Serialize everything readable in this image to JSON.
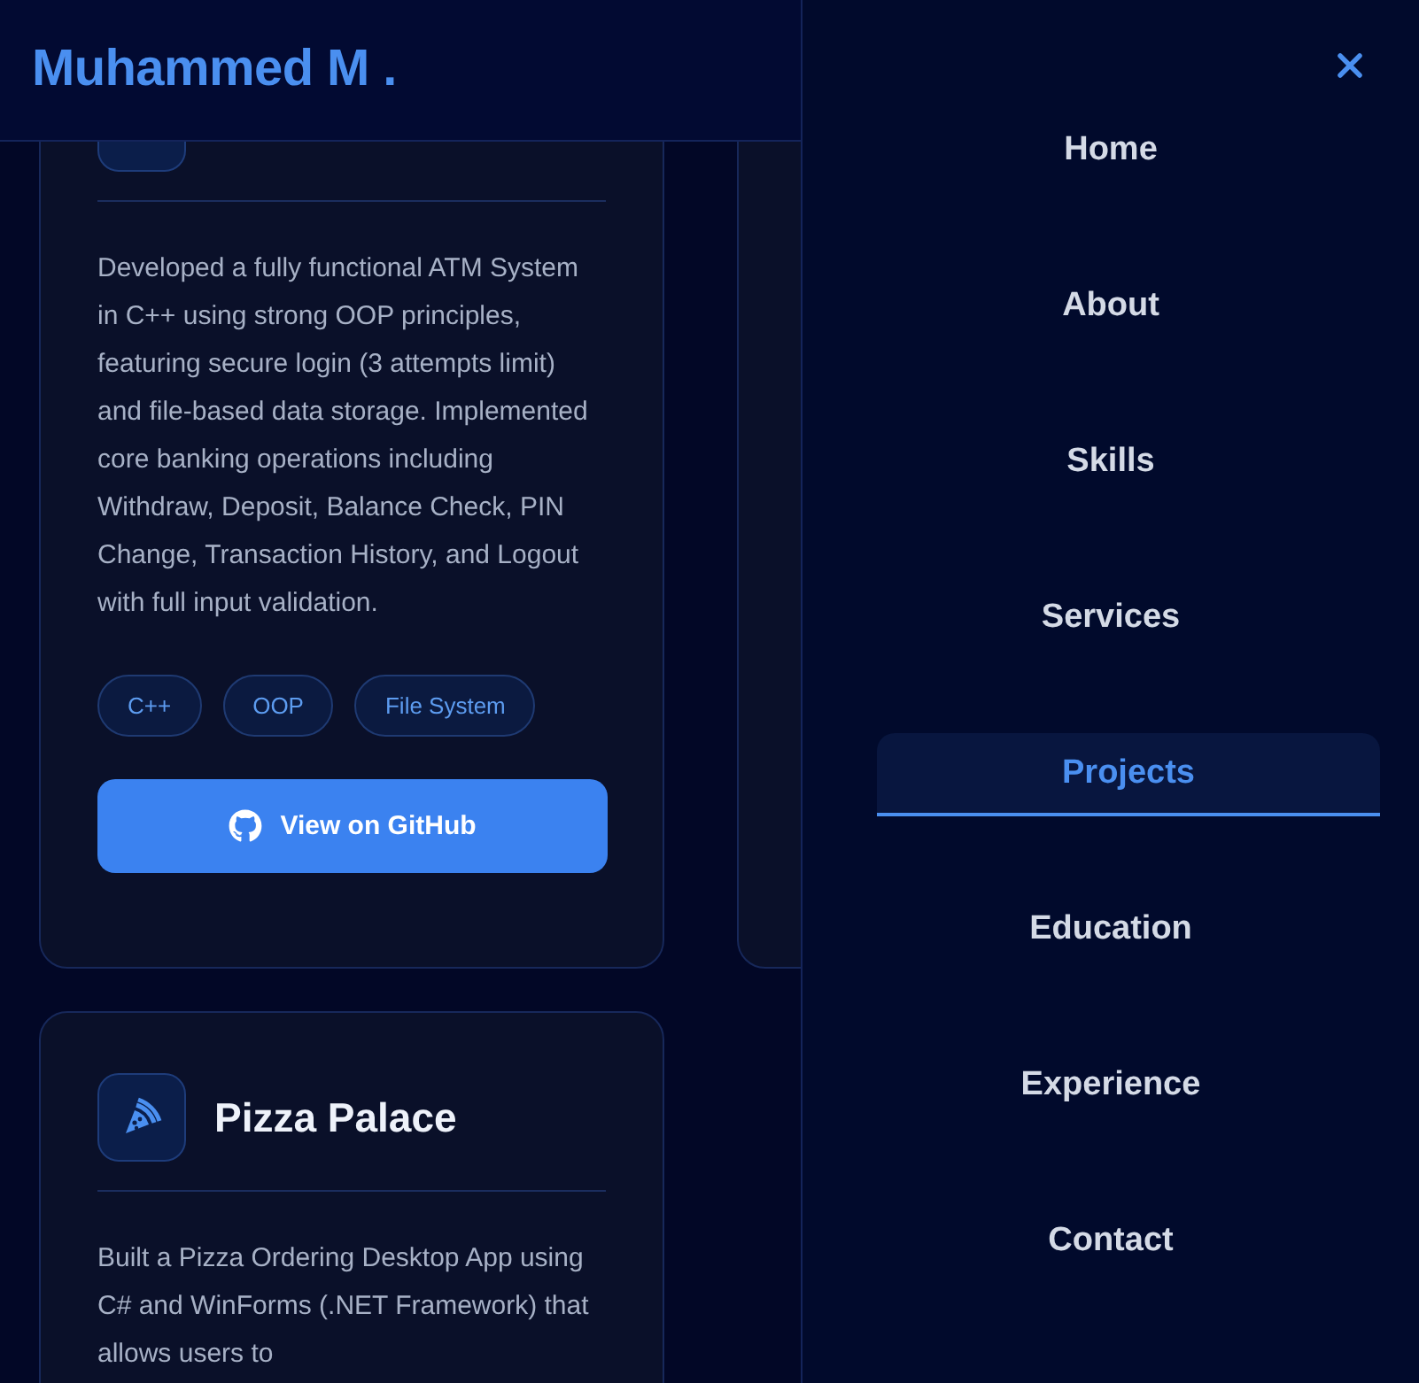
{
  "header": {
    "logo": "Muhammed M ."
  },
  "projects": [
    {
      "kind": "github",
      "description": "Developed a fully functional ATM System in C++ using strong OOP principles, featuring secure login (3 attempts limit) and file-based data storage. Implemented core banking operations including Withdraw, Deposit, Balance Check, PIN Change, Transaction History, and Logout with full input validation.",
      "tags": [
        "C++",
        "OOP",
        "File System"
      ],
      "button": "View on GitHub"
    },
    {
      "kind": "hidden"
    },
    {
      "kind": "titled",
      "title": "Pizza Palace",
      "description": "Built a Pizza Ordering Desktop App using C# and WinForms (.NET Framework) that allows users to"
    }
  ],
  "menu": {
    "items": [
      {
        "label": "Home",
        "selected": false
      },
      {
        "label": "About",
        "selected": false
      },
      {
        "label": "Skills",
        "selected": false
      },
      {
        "label": "Services",
        "selected": false
      },
      {
        "label": "Projects",
        "selected": true
      },
      {
        "label": "Education",
        "selected": false
      },
      {
        "label": "Experience",
        "selected": false
      },
      {
        "label": "Contact",
        "selected": false
      }
    ]
  }
}
